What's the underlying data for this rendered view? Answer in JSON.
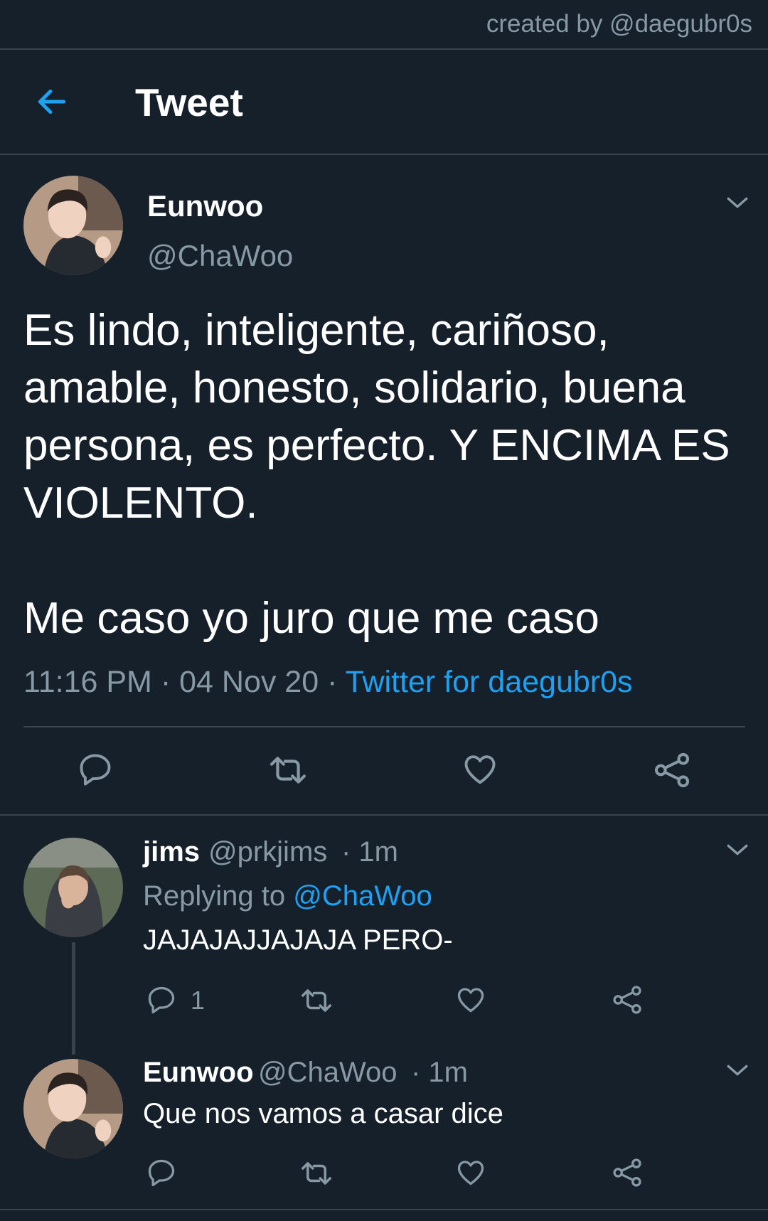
{
  "watermark": "created by @daegubr0s",
  "header": {
    "title": "Tweet",
    "back_icon": "arrow-left-icon"
  },
  "main_tweet": {
    "name": "Eunwoo",
    "handle": "@ChaWoo",
    "text": "Es lindo, inteligente, cariñoso, amable, honesto, solidario, buena persona, es perfecto. Y ENCIMA ES VIOLENTO.\n\nMe caso yo juro que me caso",
    "time": "11:16 PM",
    "date": "04 Nov 20",
    "separator": "·",
    "source": "Twitter for daegubr0s"
  },
  "replies": [
    {
      "name": "jims",
      "handle": "@prkjims",
      "age": "· 1m",
      "replying_label": "Replying to",
      "replying_to": "@ChaWoo",
      "text": "JAJAJAJJAJAJA PERO-",
      "reply_count": "1"
    },
    {
      "name": "Eunwoo",
      "handle": "@ChaWoo",
      "age": "· 1m",
      "text": "Que nos vamos a casar dice"
    }
  ],
  "colors": {
    "background": "#15202b",
    "accent": "#1da1f2",
    "muted": "#8899a6",
    "divider": "#38444d"
  }
}
